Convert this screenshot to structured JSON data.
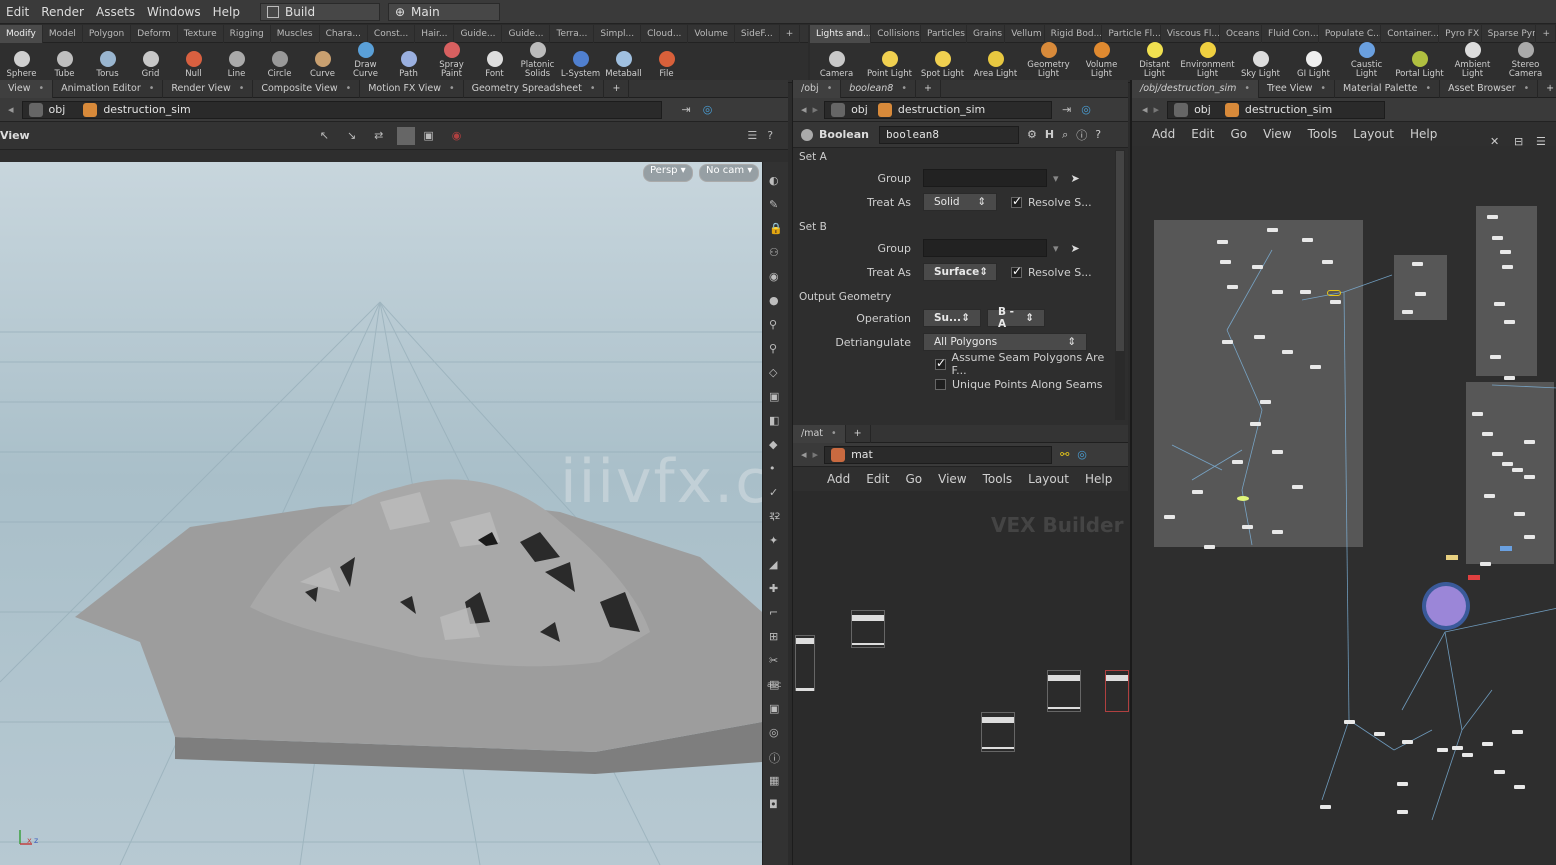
{
  "menubar": {
    "items": [
      "Edit",
      "Render",
      "Assets",
      "Windows",
      "Help"
    ],
    "desktop": "Build",
    "context": "Main"
  },
  "shelf_left": {
    "tabs": [
      "Modify",
      "Model",
      "Polygon",
      "Deform",
      "Texture",
      "Rigging",
      "Muscles",
      "Chara...",
      "Const...",
      "Hair...",
      "Guide...",
      "Guide...",
      "Terra...",
      "Simpl...",
      "Cloud...",
      "Volume",
      "SideF..."
    ],
    "tools": [
      "Sphere",
      "Tube",
      "Torus",
      "Grid",
      "Null",
      "Line",
      "Circle",
      "Curve",
      "Draw Curve",
      "Path",
      "Spray Paint",
      "Font",
      "Platonic Solids",
      "L-System",
      "Metaball",
      "File"
    ]
  },
  "shelf_right": {
    "tabs": [
      "Lights and...",
      "Collisions",
      "Particles",
      "Grains",
      "Vellum",
      "Rigid Bod...",
      "Particle Fl...",
      "Viscous Fl...",
      "Oceans",
      "Fluid Con...",
      "Populate C...",
      "Container...",
      "Pyro FX",
      "Sparse Pyr"
    ],
    "tools": [
      "Camera",
      "Point Light",
      "Spot Light",
      "Area Light",
      "Geometry Light",
      "Volume Light",
      "Distant Light",
      "Environment Light",
      "Sky Light",
      "GI Light",
      "Caustic Light",
      "Portal Light",
      "Ambient Light",
      "Stereo Camera"
    ]
  },
  "viewport": {
    "tabs": [
      "View",
      "Animation Editor",
      "Render View",
      "Composite View",
      "Motion FX View",
      "Geometry Spreadsheet"
    ],
    "path_root": "obj",
    "path_node": "destruction_sim",
    "title": "View",
    "persp": "Persp",
    "cam": "No cam",
    "watermark": "iiivfx.com",
    "axis_x": "x",
    "axis_z": "z",
    "side_label_12": "12",
    "side_label_abc": "abc"
  },
  "params": {
    "tab1": "/obj",
    "tab2": "boolean8",
    "path_root": "obj",
    "path_node": "destruction_sim",
    "node_type": "Boolean",
    "node_name": "boolean8",
    "set_a": {
      "title": "Set A",
      "group_label": "Group",
      "treat_label": "Treat As",
      "treat_value": "Solid",
      "resolve": "Resolve S..."
    },
    "set_b": {
      "title": "Set B",
      "group_label": "Group",
      "treat_label": "Treat As",
      "treat_value": "Surface",
      "resolve": "Resolve S..."
    },
    "output": {
      "title": "Output Geometry",
      "operation_label": "Operation",
      "op_value1": "Su...",
      "op_value2": "B - A",
      "detri_label": "Detriangulate",
      "detri_value": "All Polygons",
      "assume_seam": "Assume Seam Polygons Are F...",
      "unique_points": "Unique Points Along Seams"
    }
  },
  "mat": {
    "tab": "/mat",
    "path": "mat",
    "menu": [
      "Add",
      "Edit",
      "Go",
      "View",
      "Tools",
      "Layout",
      "Help"
    ],
    "vex_label": "VEX Builder"
  },
  "network": {
    "tabs": [
      "/obj/destruction_sim",
      "Tree View",
      "Material Palette",
      "Asset Browser"
    ],
    "path_root": "obj",
    "path_node": "destruction_sim",
    "menu": [
      "Add",
      "Edit",
      "Go",
      "View",
      "Tools",
      "Layout",
      "Help"
    ]
  },
  "colors": {
    "accent_yellow": "#e6c619",
    "node_purple": "#8a78d8",
    "sky_top": "#cad7de",
    "ground": "#9a9a9a"
  }
}
